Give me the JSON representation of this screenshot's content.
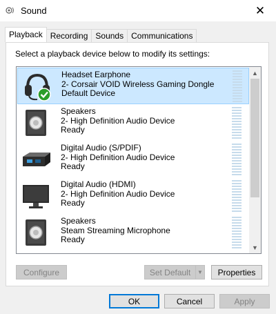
{
  "window": {
    "title": "Sound"
  },
  "tabs": [
    {
      "label": "Playback",
      "active": true
    },
    {
      "label": "Recording"
    },
    {
      "label": "Sounds"
    },
    {
      "label": "Communications"
    }
  ],
  "instruction": "Select a playback device below to modify its settings:",
  "devices": [
    {
      "icon": "headset-icon",
      "line1": "Headset Earphone",
      "line2": "2- Corsair VOID Wireless Gaming Dongle",
      "line3": "Default Device",
      "selected": true
    },
    {
      "icon": "speakers-icon",
      "line1": "Speakers",
      "line2": "2- High Definition Audio Device",
      "line3": "Ready"
    },
    {
      "icon": "digital-audio-spdif-icon",
      "line1": "Digital Audio (S/PDIF)",
      "line2": "2- High Definition Audio Device",
      "line3": "Ready"
    },
    {
      "icon": "monitor-hdmi-icon",
      "line1": "Digital Audio (HDMI)",
      "line2": "2- High Definition Audio Device",
      "line3": "Ready"
    },
    {
      "icon": "speakers-icon",
      "line1": "Speakers",
      "line2": "Steam Streaming Microphone",
      "line3": "Ready"
    }
  ],
  "buttons": {
    "configure": "Configure",
    "set_default": "Set Default",
    "properties": "Properties",
    "ok": "OK",
    "cancel": "Cancel",
    "apply": "Apply"
  },
  "colors": {
    "selection": "#cce8ff",
    "accent": "#0078d7",
    "default_check": "#2a9d2a"
  }
}
